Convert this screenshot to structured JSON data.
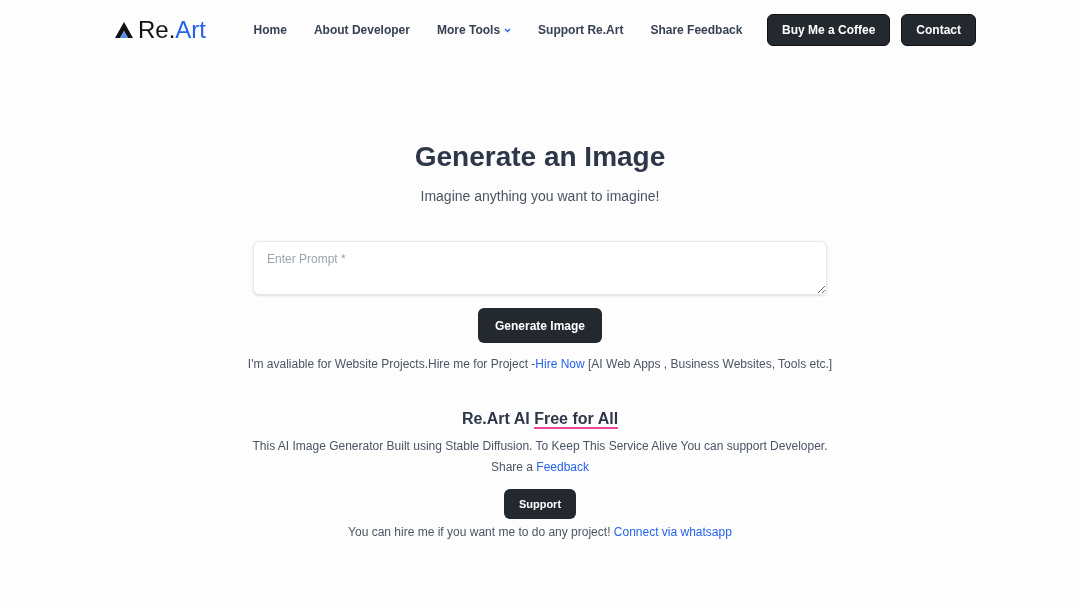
{
  "logo": {
    "text": "Re.",
    "accent": "Art"
  },
  "nav": [
    {
      "label": "Home",
      "kind": "link"
    },
    {
      "label": "About Developer",
      "kind": "link"
    },
    {
      "label": "More Tools",
      "kind": "dropdown"
    },
    {
      "label": "Support Re.Art",
      "kind": "link"
    },
    {
      "label": "Share Feedback",
      "kind": "link"
    },
    {
      "label": "Buy Me a Coffee",
      "kind": "button"
    },
    {
      "label": "Contact",
      "kind": "button"
    }
  ],
  "hero": {
    "title": "Generate an Image",
    "subtitle": "Imagine anything you want to imagine!"
  },
  "prompt": {
    "placeholder": "Enter Prompt *"
  },
  "generate_button": "Generate Image",
  "hire_note": {
    "before": "I'm avaliable for Website Projects.Hire me for Project -",
    "link": "Hire Now",
    "after": " [AI Web Apps , Business Websites, Tools etc.]"
  },
  "free_section": {
    "title": "Re.Art AI ",
    "highlight": "Free for All",
    "description": "This AI Image Generator Built using Stable Diffusion. To Keep This Service Alive You can support Developer.",
    "share_before": "Share a ",
    "share_link": "Feedback"
  },
  "support_button": "Support",
  "whatsapp_note": {
    "before": "You can hire me if you want me to do any project! ",
    "link": "Connect via whatsapp"
  }
}
